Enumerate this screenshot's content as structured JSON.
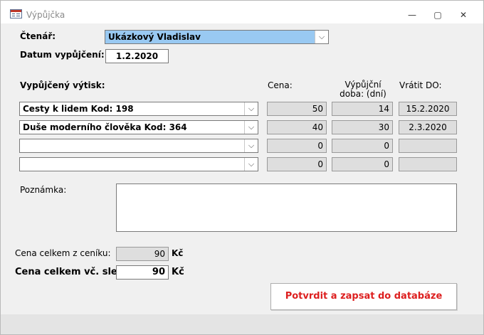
{
  "window": {
    "title": "Výpůjčka",
    "minimize_glyph": "—",
    "restore_glyph": "▢",
    "close_glyph": "✕"
  },
  "reader": {
    "label": "Čtenář:",
    "value": "Ukázkový Vladislav"
  },
  "loan_date": {
    "label": "Datum vypůjčení:",
    "value": "1.2.2020"
  },
  "items_section": {
    "header_item": "Vypůjčený výtisk:",
    "header_price": "Cena:",
    "header_period": "Výpůjční doba: (dní)",
    "header_return": "Vrátit DO:",
    "rows": [
      {
        "book": "Cesty k lidem Kod: 198",
        "price": "50",
        "days": "14",
        "return_date": "15.2.2020"
      },
      {
        "book": "Duše moderního člověka Kod: 364",
        "price": "40",
        "days": "30",
        "return_date": "2.3.2020"
      },
      {
        "book": "",
        "price": "0",
        "days": "0",
        "return_date": ""
      },
      {
        "book": "",
        "price": "0",
        "days": "0",
        "return_date": ""
      }
    ]
  },
  "note": {
    "label": "Poznámka:",
    "value": ""
  },
  "totals": {
    "list_price_label": "Cena celkem z ceníku:",
    "list_price_value": "90",
    "list_price_currency": "Kč",
    "discount_price_label": "Cena celkem vč. slev:",
    "discount_price_value": "90",
    "discount_price_currency": "Kč"
  },
  "submit": {
    "label": "Potvrdit a zapsat do databáze"
  },
  "icons": {
    "chevron": "chevron-down-icon"
  }
}
